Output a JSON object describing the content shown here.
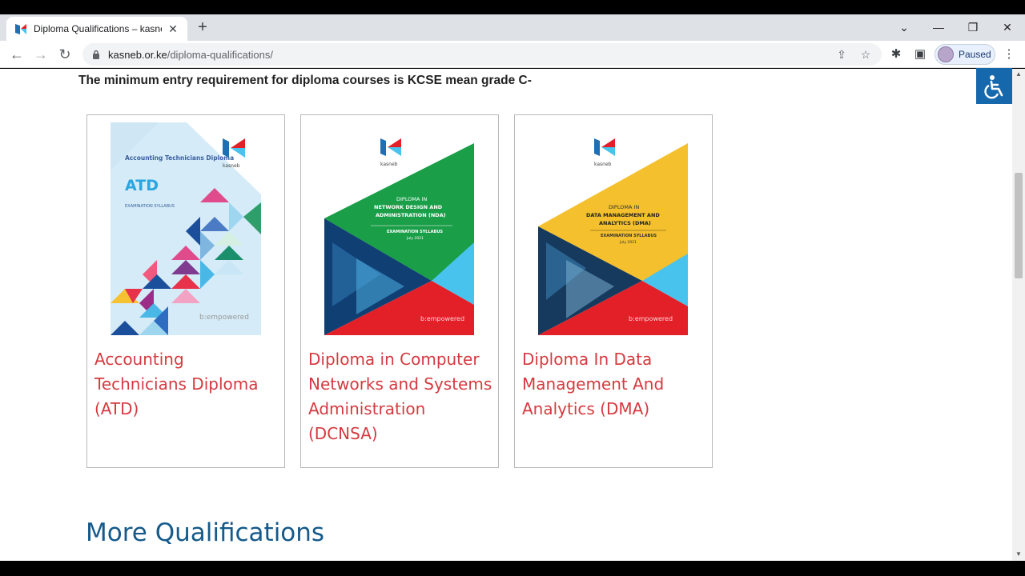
{
  "browser": {
    "tab_title": "Diploma Qualifications – kasneb",
    "tab_close": "✕",
    "new_tab": "+",
    "url_host": "kasneb.or.ke",
    "url_path": "/diploma-qualifications/",
    "profile_status": "Paused",
    "window_controls": {
      "minimize": "—",
      "maximize": "❐",
      "close": "✕"
    },
    "icons": [
      "back-icon",
      "forward-icon",
      "reload-icon",
      "share-icon",
      "star-icon",
      "extensions-icon",
      "side-panel-icon",
      "menu-icon"
    ]
  },
  "page": {
    "entry_note": "The minimum entry requirement for diploma courses is KCSE mean grade C-",
    "cards": [
      {
        "title": "Accounting Technicians Diploma (ATD)",
        "cover": {
          "heading": "Accounting Technicians Diploma",
          "abbr": "ATD",
          "sub": "EXAMINATION SYLLABUS",
          "logo": "kasneb",
          "tagline": "b:empowered"
        }
      },
      {
        "title": "Diploma in Computer Networks and Systems Administration (DCNSA)",
        "cover": {
          "line1": "DIPLOMA IN",
          "line2": "NETWORK DESIGN AND",
          "line3": "ADMINISTRATION (NDA)",
          "sub": "EXAMINATION SYLLABUS",
          "date": "July 2021",
          "logo": "kasneb",
          "tagline": "b:empowered"
        }
      },
      {
        "title": "Diploma In Data Management And Analytics (DMA)",
        "cover": {
          "line1": "DIPLOMA IN",
          "line2": "DATA MANAGEMENT AND",
          "line3": "ANALYTICS (DMA)",
          "sub": "EXAMINATION SYLLABUS",
          "date": "July 2021",
          "logo": "kasneb",
          "tagline": "b:empowered"
        }
      }
    ],
    "more_heading": "More Qualifications"
  },
  "colors": {
    "link_red": "#d53a3f",
    "heading_blue": "#155a8a",
    "accessibility_blue": "#1668ad",
    "nda_green": "#1a9e48",
    "dma_yellow": "#f4c02d",
    "cover_red": "#e31f27",
    "cover_cyan": "#48c3ee"
  }
}
